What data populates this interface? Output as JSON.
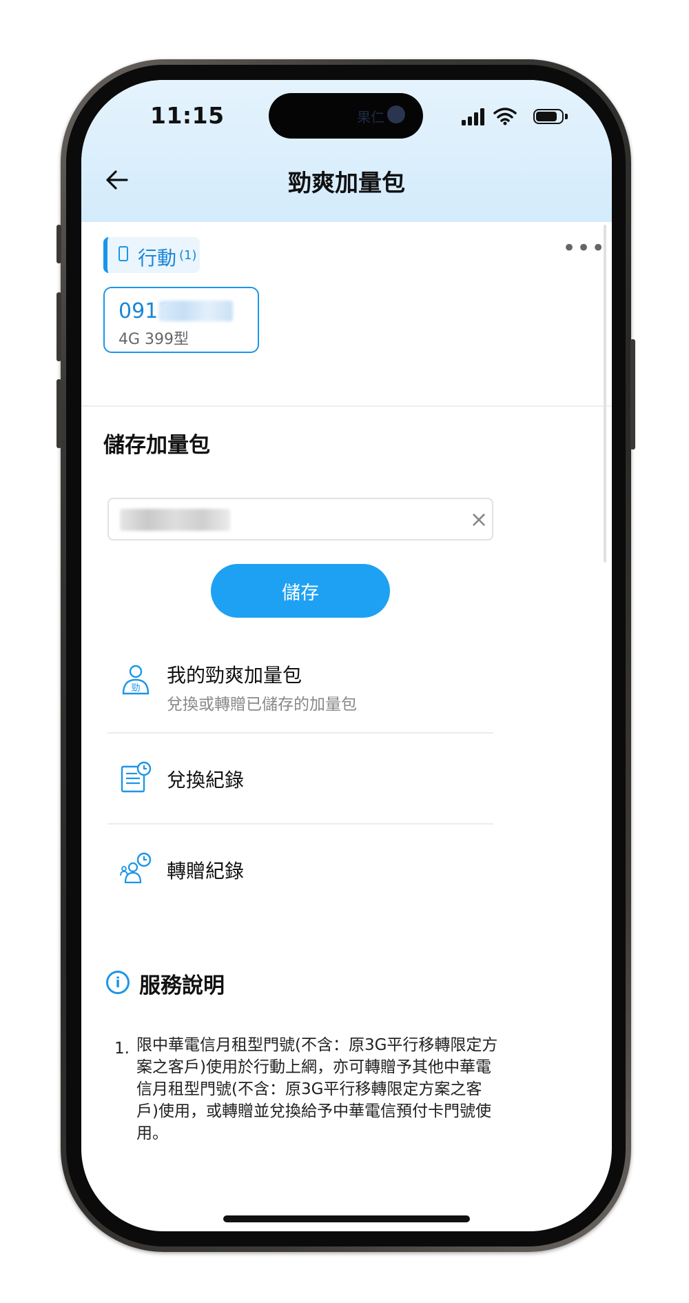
{
  "status_bar": {
    "time": "11:15",
    "island_text": "果仁"
  },
  "header": {
    "back_icon": "arrow-left-icon",
    "title": "勁爽加量包"
  },
  "account": {
    "tab_label": "行動",
    "tab_count": "(1)",
    "line_number_visible": "0911",
    "line_plan": "4G 399型"
  },
  "store_section": {
    "title": "儲存加量包",
    "save_label": "儲存"
  },
  "menu": {
    "items": [
      {
        "icon": "person-badge-icon",
        "title": "我的勁爽加量包",
        "subtitle": "兌換或轉贈已儲存的加量包"
      },
      {
        "icon": "document-clock-icon",
        "title": "兌換紀錄"
      },
      {
        "icon": "people-clock-icon",
        "title": "轉贈紀錄"
      }
    ]
  },
  "service": {
    "title": "服務說明",
    "rules": [
      {
        "number": "1.",
        "text": "限中華電信月租型門號(不含：原3G平行移轉限定方案之客戶)使用於行動上網，亦可轉贈予其他中華電信月租型門號(不含：原3G平行移轉限定方案之客戶)使用，或轉贈並兌換給予中華電信預付卡門號使用。"
      }
    ]
  },
  "colors": {
    "accent": "#1b95e8",
    "button": "#1ea1f2",
    "header_bg": "#dcf0fd"
  }
}
